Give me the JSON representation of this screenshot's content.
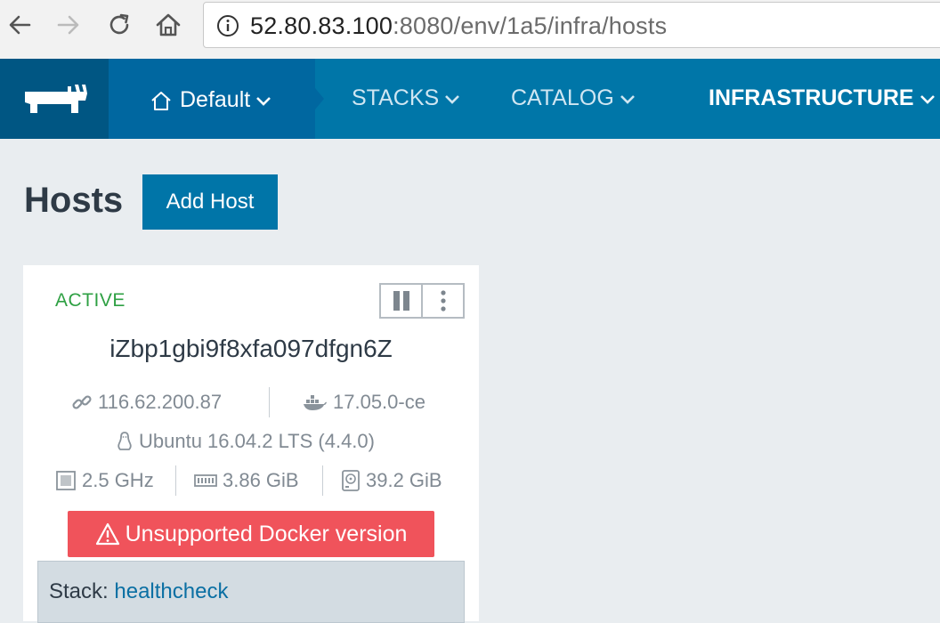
{
  "browser": {
    "url_host": "52.80.83.100",
    "url_rest": ":8080/env/1a5/infra/hosts"
  },
  "header": {
    "environment": "Default",
    "nav": [
      {
        "label": "STACKS"
      },
      {
        "label": "CATALOG"
      },
      {
        "label": "INFRASTRUCTURE"
      }
    ]
  },
  "page": {
    "title": "Hosts",
    "add_host_label": "Add Host"
  },
  "host": {
    "state": "ACTIVE",
    "name": "iZbp1gbi9f8xfa097dfgn6Z",
    "ip": "116.62.200.87",
    "docker_version": "17.05.0-ce",
    "os": "Ubuntu 16.04.2 LTS (4.4.0)",
    "cpu": "2.5 GHz",
    "memory": "3.86 GiB",
    "storage": "39.2 GiB",
    "warning": "Unsupported Docker version",
    "stack_label": "Stack:",
    "stack_name": "healthcheck"
  },
  "colors": {
    "header": "#0076a8",
    "logo_bg": "#005683",
    "env_bg": "#0067a0",
    "active_state": "#2ea043",
    "warning": "#f0535b",
    "primary_button": "#0075a8"
  },
  "icons": [
    "back-icon",
    "forward-icon",
    "reload-icon",
    "home-icon",
    "info-icon",
    "rancher-logo-icon",
    "house-icon",
    "chevron-down-icon",
    "pause-icon",
    "more-vertical-icon",
    "link-icon",
    "docker-icon",
    "linux-icon",
    "cpu-icon",
    "memory-icon",
    "storage-icon",
    "warning-icon"
  ]
}
